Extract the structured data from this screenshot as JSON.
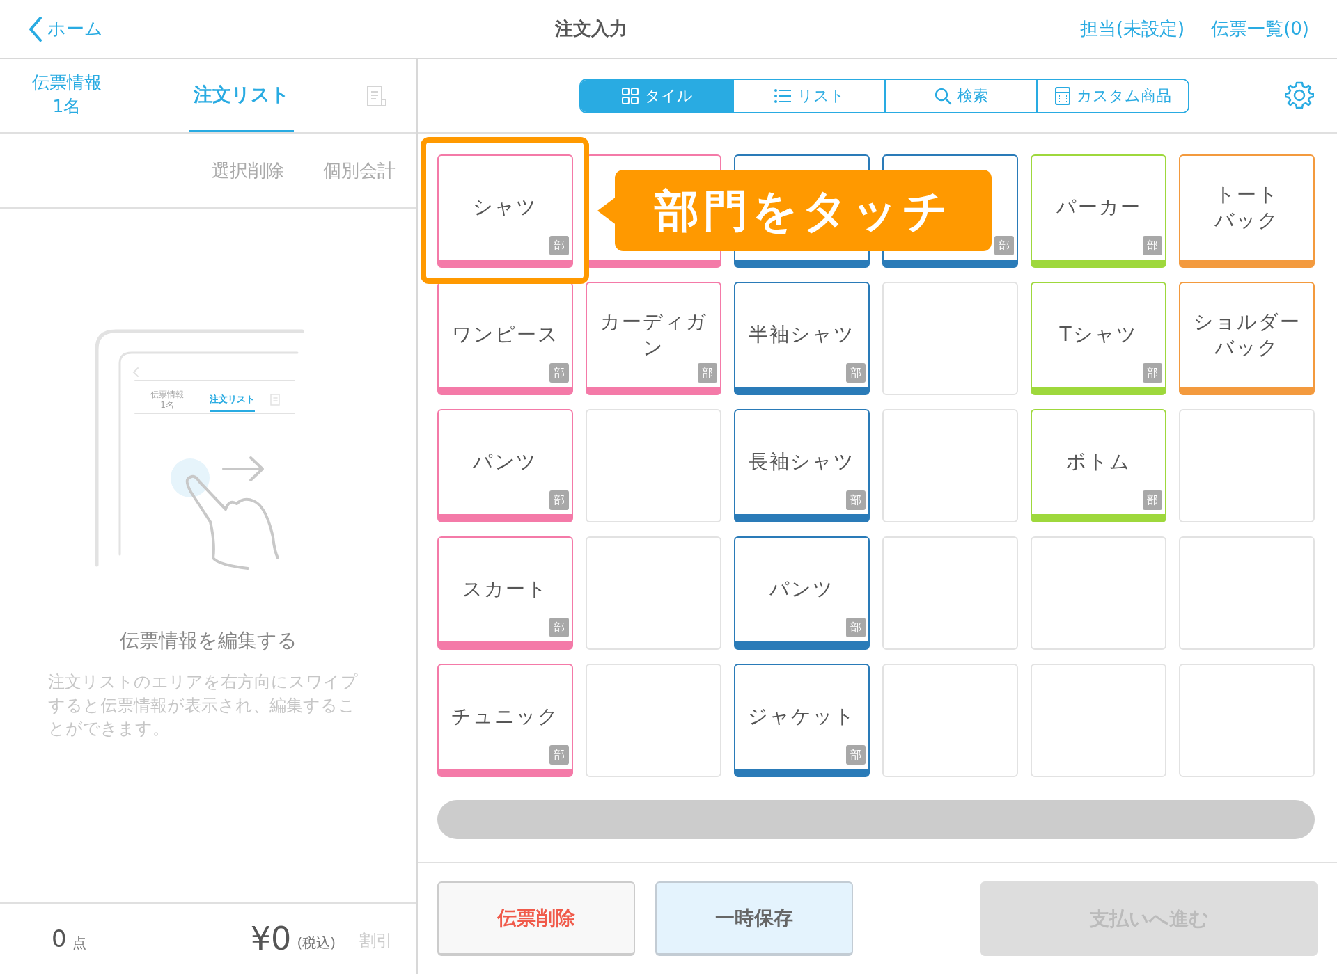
{
  "header": {
    "back": "ホーム",
    "title": "注文入力",
    "links": [
      "担当(未設定)",
      "伝票一覧(0)"
    ]
  },
  "left_tabs": [
    {
      "label": "伝票情報",
      "sub": "1名",
      "selected": false
    },
    {
      "label": "注文リスト",
      "selected": true
    }
  ],
  "actions": [
    {
      "label": "選択削除",
      "disabled": true
    },
    {
      "label": "個別会計",
      "disabled": true
    }
  ],
  "hint": {
    "illustration": {
      "info_label": "伝票情報",
      "info_count": "1名",
      "list_label": "注文リスト"
    },
    "title": "伝票情報を編集する",
    "text": "注文リストのエリアを右方向にスワイプすると伝票情報が表示され、編集することができます。"
  },
  "footer": {
    "count": "0",
    "count_unit": "点",
    "total": "¥0",
    "tax_note": "(税込)",
    "discount": "割引"
  },
  "view_tabs": [
    {
      "label": "タイル",
      "selected": true
    },
    {
      "label": "リスト",
      "selected": false
    },
    {
      "label": "検索",
      "selected": false
    },
    {
      "label": "カスタム商品",
      "selected": false
    }
  ],
  "tiles": [
    {
      "kind": "department",
      "label": "シャツ",
      "badge": "部",
      "color": "#f47aa8"
    },
    {
      "kind": "department",
      "color": "#f47aa8"
    },
    {
      "kind": "department",
      "color": "#2a7bb8"
    },
    {
      "kind": "department",
      "badge": "部",
      "color": "#2a7bb8"
    },
    {
      "kind": "department",
      "label": "パーカー",
      "badge": "部",
      "color": "#9ed83c"
    },
    {
      "kind": "department",
      "lines": [
        "トート",
        "バック"
      ],
      "color": "#f39a3e"
    },
    {
      "kind": "department",
      "label": "ワンピース",
      "badge": "部",
      "color": "#f47aa8"
    },
    {
      "kind": "department",
      "lines": [
        "カーディガ",
        "ン"
      ],
      "badge": "部",
      "color": "#f47aa8"
    },
    {
      "kind": "department",
      "label": "半袖シャツ",
      "badge": "部",
      "color": "#2a7bb8"
    },
    {
      "kind": "empty"
    },
    {
      "kind": "department",
      "label": "Tシャツ",
      "badge": "部",
      "color": "#9ed83c"
    },
    {
      "kind": "department",
      "lines": [
        "ショルダー",
        "バック"
      ],
      "color": "#f39a3e"
    },
    {
      "kind": "department",
      "label": "パンツ",
      "badge": "部",
      "color": "#f47aa8"
    },
    {
      "kind": "empty"
    },
    {
      "kind": "department",
      "label": "長袖シャツ",
      "badge": "部",
      "color": "#2a7bb8"
    },
    {
      "kind": "empty"
    },
    {
      "kind": "department",
      "label": "ボトム",
      "badge": "部",
      "color": "#9ed83c"
    },
    {
      "kind": "empty"
    },
    {
      "kind": "department",
      "label": "スカート",
      "badge": "部",
      "color": "#f47aa8"
    },
    {
      "kind": "empty"
    },
    {
      "kind": "department",
      "label": "パンツ",
      "badge": "部",
      "color": "#2a7bb8"
    },
    {
      "kind": "empty"
    },
    {
      "kind": "empty"
    },
    {
      "kind": "empty"
    },
    {
      "kind": "department",
      "label": "チュニック",
      "badge": "部",
      "color": "#f47aa8"
    },
    {
      "kind": "empty"
    },
    {
      "kind": "department",
      "label": "ジャケット",
      "badge": "部",
      "color": "#2a7bb8"
    },
    {
      "kind": "empty"
    },
    {
      "kind": "empty"
    },
    {
      "kind": "empty"
    }
  ],
  "callout": {
    "text": "部門をタッチ"
  },
  "buttons": [
    {
      "label": "伝票削除",
      "kind": "danger",
      "disabled": false
    },
    {
      "label": "一時保存",
      "kind": "save",
      "disabled": false
    },
    {
      "label": "支払いへ進む",
      "kind": "pay",
      "disabled": true
    }
  ]
}
